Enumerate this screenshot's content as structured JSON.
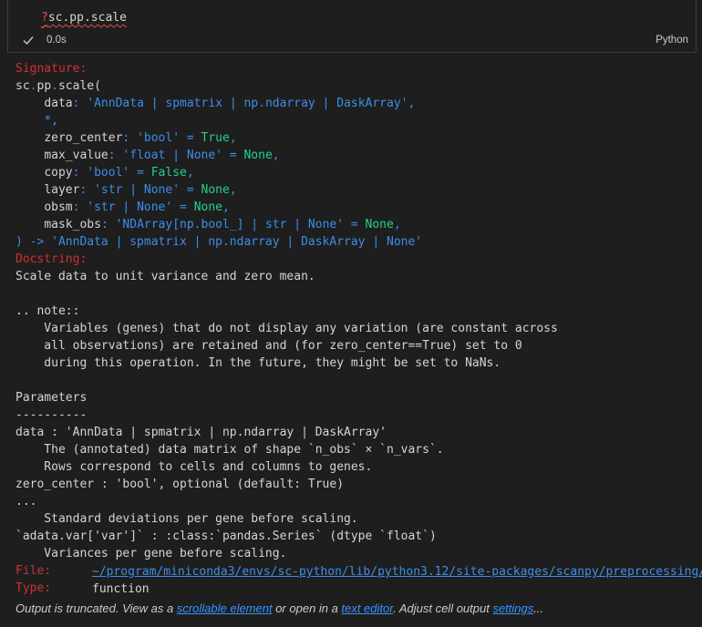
{
  "cell": {
    "code_prefix": "?",
    "code_rest": "sc.pp.scale",
    "exec_time": "0.0s",
    "language": "Python"
  },
  "signature": {
    "label": "Signature:",
    "func_name": "sc.pp.scale(",
    "params": [
      {
        "name": "data",
        "type": "'AnnData | spmatrix | np.ndarray | DaskArray'",
        "default": ""
      },
      {
        "name": "*",
        "type": "",
        "default": ""
      },
      {
        "name": "zero_center",
        "type": "'bool'",
        "default": "True"
      },
      {
        "name": "max_value",
        "type": "'float | None'",
        "default": "None"
      },
      {
        "name": "copy",
        "type": "'bool'",
        "default": "False"
      },
      {
        "name": "layer",
        "type": "'str | None'",
        "default": "None"
      },
      {
        "name": "obsm",
        "type": "'str | None'",
        "default": "None"
      },
      {
        "name": "mask_obs",
        "type": "'NDArray[np.bool_] | str | None'",
        "default": "None"
      }
    ],
    "return_line": ") -> 'AnnData | spmatrix | np.ndarray | DaskArray | None'"
  },
  "docstring": {
    "label": "Docstring:",
    "lines": [
      "Scale data to unit variance and zero mean.",
      "",
      ".. note::",
      "    Variables (genes) that do not display any variation (are constant across",
      "    all observations) are retained and (for zero_center==True) set to 0",
      "    during this operation. In the future, they might be set to NaNs.",
      "",
      "Parameters",
      "----------",
      "data : 'AnnData | spmatrix | np.ndarray | DaskArray'",
      "    The (annotated) data matrix of shape `n_obs` × `n_vars`.",
      "    Rows correspond to cells and columns to genes.",
      "zero_center : 'bool', optional (default: True)",
      "...",
      "    Standard deviations per gene before scaling.",
      "`adata.var['var']` : :class:`pandas.Series` (dtype `float`)",
      "    Variances per gene before scaling."
    ]
  },
  "file": {
    "label": "File:",
    "path": "~/program/miniconda3/envs/sc-python/lib/python3.12/site-packages/scanpy/preprocessing/"
  },
  "type_info": {
    "label": "Type:",
    "value": "function"
  },
  "footer": {
    "text1": "Output is truncated. View as a ",
    "link1": "scrollable element",
    "text2": " or open in a ",
    "link2": "text editor",
    "text3": ". Adjust cell output ",
    "link3": "settings",
    "text4": "..."
  },
  "colors": {
    "background": "#1e1e1e",
    "label_red": "#cd3131",
    "type_blue": "#3b8eea",
    "value_green": "#23d18b",
    "text": "#d4d4d4"
  }
}
